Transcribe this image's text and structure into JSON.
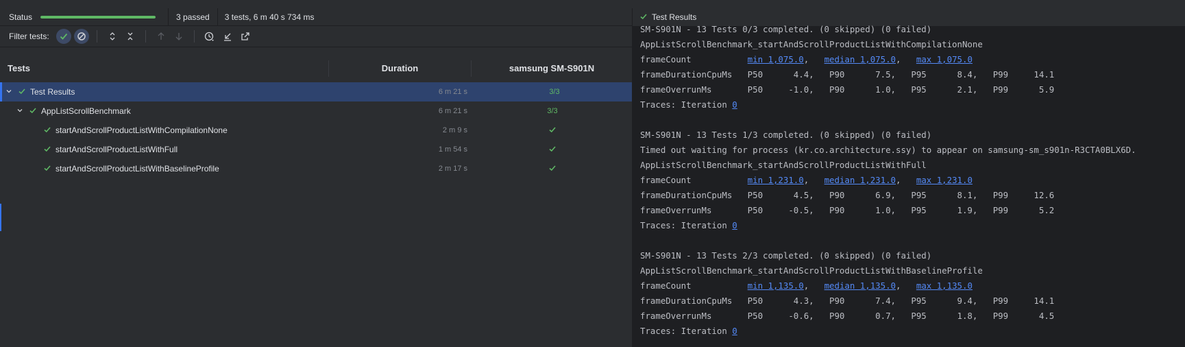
{
  "status": {
    "label": "Status",
    "progress": 1.0,
    "passed": "3 passed",
    "summary": "3 tests, 6 m 40 s 734 ms"
  },
  "toolbar": {
    "filter_label": "Filter tests:",
    "icons": [
      "show-passed-icon",
      "show-ignored-icon",
      "expand-all-icon",
      "collapse-all-icon",
      "previous-failed-icon",
      "next-failed-icon",
      "history-icon",
      "import-results-icon",
      "export-results-icon"
    ]
  },
  "table": {
    "col_tests": "Tests",
    "col_duration": "Duration",
    "col_device": "samsung SM-S901N"
  },
  "tree": [
    {
      "name": "Test Results",
      "duration": "6 m 21 s",
      "result": "3/3"
    },
    {
      "name": "AppListScrollBenchmark",
      "duration": "6 m 21 s",
      "result": "3/3"
    },
    {
      "name": "startAndScrollProductListWithCompilationNone",
      "duration": "2 m 9 s",
      "result": "check"
    },
    {
      "name": "startAndScrollProductListWithFull",
      "duration": "1 m 54 s",
      "result": "check"
    },
    {
      "name": "startAndScrollProductListWithBaselineProfile",
      "duration": "2 m 17 s",
      "result": "check"
    }
  ],
  "right": {
    "title": "Test Results",
    "blocks": [
      {
        "header": "SM-S901N - 13 Tests 0/3 completed. (0 skipped) (0 failed)",
        "timeout": "",
        "test": "AppListScrollBenchmark_startAndScrollProductListWithCompilationNone",
        "fc_label": "frameCount",
        "fc_min": "min 1,075.0",
        "fc_median": "median 1,075.0",
        "fc_max": "max 1,075.0",
        "cpu": "frameDurationCpuMs   P50      4.4,   P90      7.5,   P95      8.4,   P99     14.1",
        "over": "frameOverrunMs       P50     -1.0,   P90      1.0,   P95      2.1,   P99      5.9",
        "traces": "Traces: Iteration ",
        "iter": "0"
      },
      {
        "header": "SM-S901N - 13 Tests 1/3 completed. (0 skipped) (0 failed)",
        "timeout": "Timed out waiting for process (kr.co.architecture.ssy) to appear on samsung-sm_s901n-R3CTA0BLX6D.",
        "test": "AppListScrollBenchmark_startAndScrollProductListWithFull",
        "fc_label": "frameCount",
        "fc_min": "min 1,231.0",
        "fc_median": "median 1,231.0",
        "fc_max": "max 1,231.0",
        "cpu": "frameDurationCpuMs   P50      4.5,   P90      6.9,   P95      8.1,   P99     12.6",
        "over": "frameOverrunMs       P50     -0.5,   P90      1.0,   P95      1.9,   P99      5.2",
        "traces": "Traces: Iteration ",
        "iter": "0"
      },
      {
        "header": "SM-S901N - 13 Tests 2/3 completed. (0 skipped) (0 failed)",
        "timeout": "",
        "test": "AppListScrollBenchmark_startAndScrollProductListWithBaselineProfile",
        "fc_label": "frameCount",
        "fc_min": "min 1,135.0",
        "fc_median": "median 1,135.0",
        "fc_max": "max 1,135.0",
        "cpu": "frameDurationCpuMs   P50      4.3,   P90      7.4,   P95      9.4,   P99     14.1",
        "over": "frameOverrunMs       P50     -0.6,   P90      0.7,   P95      1.8,   P99      4.5",
        "traces": "Traces: Iteration ",
        "iter": "0"
      }
    ]
  },
  "colors": {
    "success": "#5fb865",
    "link": "#548af7",
    "selection": "#2e436e",
    "accent": "#3574f0"
  }
}
